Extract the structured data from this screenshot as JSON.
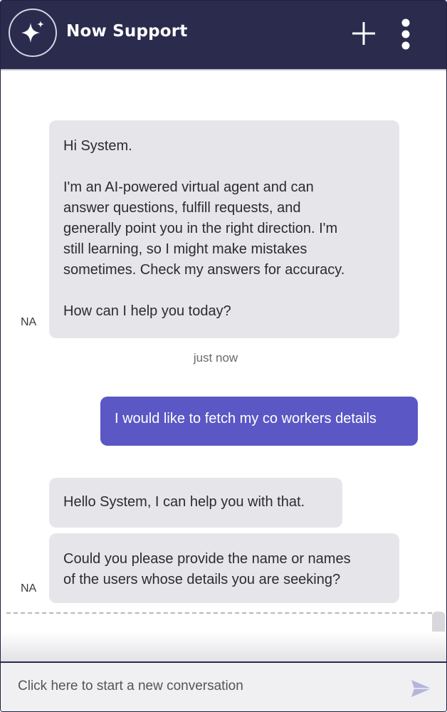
{
  "header": {
    "title": "Now Support",
    "logo_icon": "sparkle-icon",
    "new_chat_icon": "plus-icon",
    "menu_icon": "kebab-menu-icon",
    "background_color": "#2a2b4d"
  },
  "messages": {
    "welcome": {
      "greeting": "Hi System.",
      "lines": [
        "I'm an AI-powered virtual agent and can",
        "answer questions, fulfill requests, and",
        "generally point you in the right direction. I'm",
        "still learning, so I might make mistakes",
        "sometimes. Check my answers for accuracy."
      ],
      "question": "How can I help you today?",
      "avatar": "NA"
    },
    "timestamp": "just now",
    "user": {
      "text": "I would like to fetch my co workers details",
      "color": "#5b57c4"
    },
    "reply1": {
      "text": "Hello System, I can help you with that."
    },
    "reply2": {
      "lines": [
        "Could you please provide the name or names",
        "of the users whose details you are seeking?"
      ],
      "avatar": "NA"
    }
  },
  "composer": {
    "placeholder": "Click here to start a new conversation",
    "send_icon": "send-icon"
  }
}
